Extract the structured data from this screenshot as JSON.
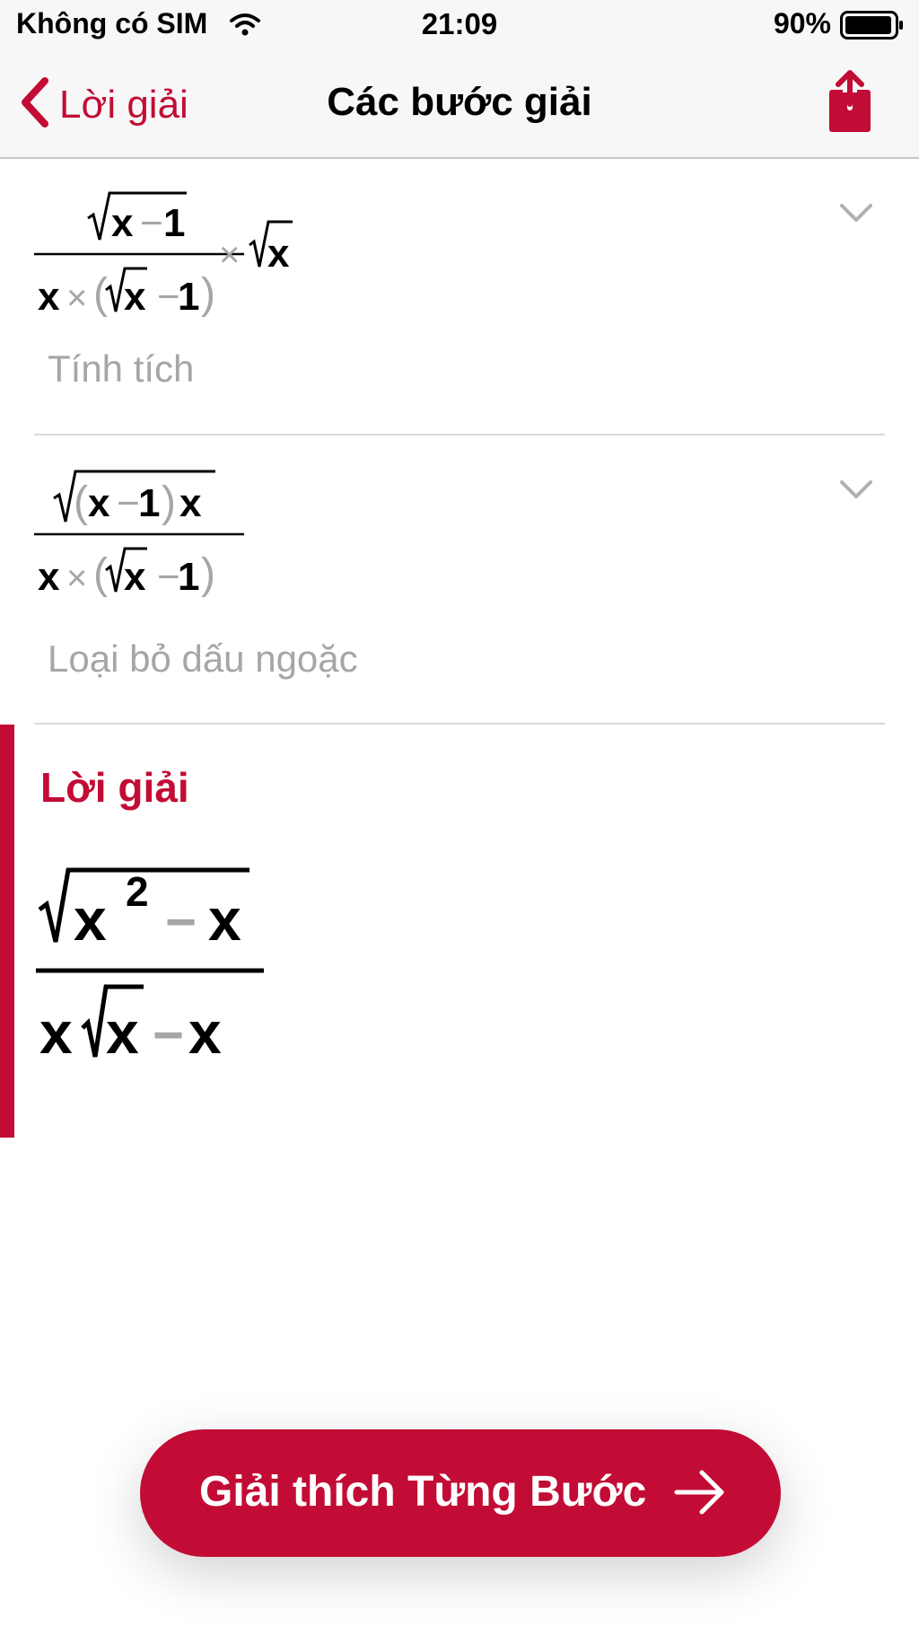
{
  "status_bar": {
    "carrier": "Không có SIM",
    "time": "21:09",
    "battery": "90%",
    "wifi_icon": "wifi-icon",
    "battery_icon": "battery-icon"
  },
  "nav": {
    "back_label": "Lời giải",
    "title": "Các bước giải",
    "back_icon": "chevron-left-icon",
    "share_icon": "share-icon"
  },
  "steps": [
    {
      "numerator": {
        "radicand": [
          "x",
          "−",
          "1"
        ]
      },
      "denominator": [
        "x",
        "×",
        "(",
        "√x",
        "−",
        "1",
        ")"
      ],
      "tail": [
        "×",
        "√x"
      ],
      "description": "Tính tích"
    },
    {
      "numerator": {
        "radicand": [
          "(",
          "x",
          "−",
          "1",
          ")",
          "x"
        ]
      },
      "denominator": [
        "x",
        "×",
        "(",
        "√x",
        "−",
        "1",
        ")"
      ],
      "description": "Loại bỏ dấu ngoặc"
    }
  ],
  "result": {
    "label": "Lời giải",
    "numerator": [
      "x",
      "2",
      "−",
      "x"
    ],
    "denominator": [
      "x",
      "√x",
      "−",
      "x"
    ]
  },
  "cta": {
    "label": "Giải thích Từng Bước",
    "arrow_icon": "arrow-right-icon"
  },
  "colors": {
    "accent": "#c20c35",
    "muted": "#a6a6a6",
    "divider": "#d9d9d9"
  }
}
